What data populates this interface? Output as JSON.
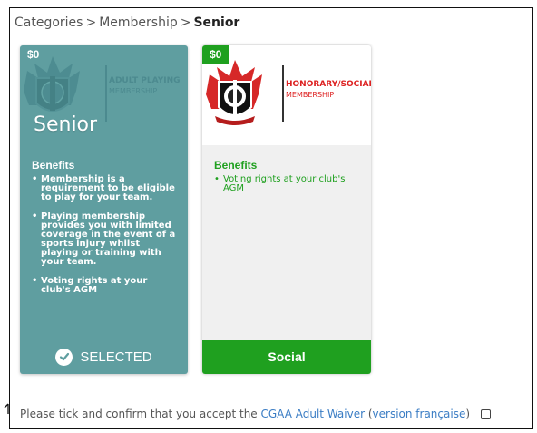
{
  "breadcrumb": {
    "items": [
      "Categories",
      "Membership"
    ],
    "separator": ">",
    "current": "Senior"
  },
  "cards": [
    {
      "price": "$0",
      "logo_title": "ADULT PLAYING",
      "logo_subtitle": "MEMBERSHIP",
      "title": "Senior",
      "benefits_heading": "Benefits",
      "benefits": [
        "Membership is a requirement to be eligible to play for your team.",
        "Playing membership provides you with limited coverage in the event of a sports injury whilst playing or training with your team.",
        "Voting rights at your club's AGM"
      ],
      "action_label": "SELECTED",
      "state": "selected",
      "color": "#5f9ea0"
    },
    {
      "price": "$0",
      "logo_title": "HONORARY/SOCIAL",
      "logo_subtitle": "MEMBERSHIP",
      "benefits_heading": "Benefits",
      "benefits": [
        "Voting rights at your club's AGM"
      ],
      "action_label": "Social",
      "state": "unselected",
      "color": "#1fa01f"
    }
  ],
  "waiver": {
    "text_before": "Please tick and confirm that you accept the ",
    "link_label": "CGAA Adult Waiver",
    "text_middle": " (",
    "alt_link_label": "version française",
    "text_after": ")",
    "checked": false
  },
  "icons": {
    "check": "check-circle-icon",
    "crest": "club-crest-icon"
  }
}
